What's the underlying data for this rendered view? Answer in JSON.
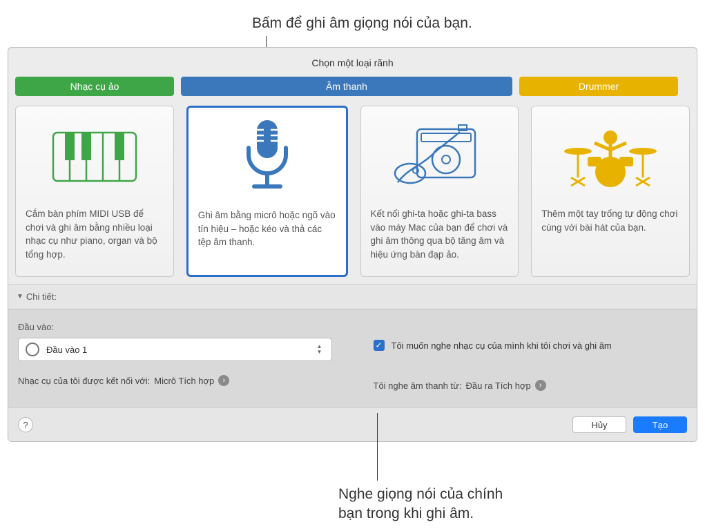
{
  "callout_top": "Bấm để ghi âm giọng nói của bạn.",
  "callout_bottom": "Nghe giọng nói của chính\nbạn trong khi ghi âm.",
  "panel_title": "Chọn một loại rãnh",
  "tabs": {
    "virtual": "Nhạc cụ ảo",
    "audio": "Âm thanh",
    "drummer": "Drummer"
  },
  "cards": {
    "piano": "Cắm bàn phím MIDI USB để chơi và ghi âm bằng nhiều loại nhạc cụ như piano, organ và bộ tổng hợp.",
    "mic": "Ghi âm bằng micrô hoặc ngõ vào tín hiệu – hoặc kéo và thả các tệp âm thanh.",
    "guitar": "Kết nối ghi-ta hoặc ghi-ta bass vào máy Mac của bạn để chơi và ghi âm thông qua bộ tăng âm và hiệu ứng bàn đạp ảo.",
    "drums": "Thêm một tay trống tự động chơi cùng với bài hát của bạn."
  },
  "details_label": "Chi tiết:",
  "input": {
    "label": "Đầu vào:",
    "selected": "Đầu vào 1"
  },
  "connected": {
    "prefix": "Nhạc cụ của tôi được kết nối với:",
    "value": "Micrô Tích hợp"
  },
  "monitor_checkbox": "Tôi muốn nghe nhạc cụ của mình khi tôi chơi và ghi âm",
  "hear": {
    "prefix": "Tôi nghe âm thanh từ:",
    "value": "Đầu ra Tích hợp"
  },
  "buttons": {
    "help": "?",
    "cancel": "Hủy",
    "create": "Tạo"
  },
  "colors": {
    "green": "#3fa648",
    "blue": "#3b78bb",
    "yellow": "#e8b300",
    "primary": "#1a7bff"
  }
}
